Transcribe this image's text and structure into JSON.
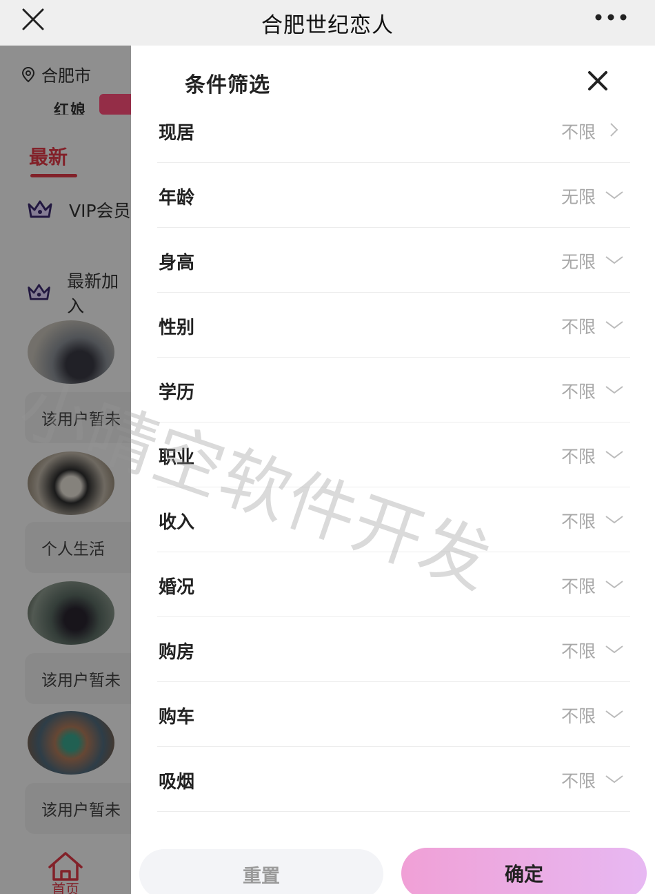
{
  "topbar": {
    "title": "合肥世纪恋人"
  },
  "background": {
    "location": "合肥市",
    "banner_text": "红娘",
    "tab_new": "最新",
    "vip_row": "VIP会员",
    "newest_row": "最新加入",
    "cards": [
      "该用户暂未",
      "个人生活",
      "该用户暂未",
      "该用户暂未"
    ],
    "home_label": "首页"
  },
  "panel": {
    "title": "条件筛选",
    "rows": [
      {
        "label": "现居",
        "value": "不限",
        "arrow": "chevron-right-icon"
      },
      {
        "label": "年龄",
        "value": "无限",
        "arrow": "chevron-down-icon"
      },
      {
        "label": "身高",
        "value": "无限",
        "arrow": "chevron-down-icon"
      },
      {
        "label": "性别",
        "value": "不限",
        "arrow": "chevron-down-icon"
      },
      {
        "label": "学历",
        "value": "不限",
        "arrow": "chevron-down-icon"
      },
      {
        "label": "职业",
        "value": "不限",
        "arrow": "chevron-down-icon"
      },
      {
        "label": "收入",
        "value": "不限",
        "arrow": "chevron-down-icon"
      },
      {
        "label": "婚况",
        "value": "不限",
        "arrow": "chevron-down-icon"
      },
      {
        "label": "购房",
        "value": "不限",
        "arrow": "chevron-down-icon"
      },
      {
        "label": "购车",
        "value": "不限",
        "arrow": "chevron-down-icon"
      },
      {
        "label": "吸烟",
        "value": "不限",
        "arrow": "chevron-down-icon"
      }
    ],
    "reset_label": "重置",
    "confirm_label": "确定"
  },
  "watermark": "小晴空软件开发",
  "colors": {
    "accent_red": "#e03a48",
    "confirm_gradient_start": "#f0a0d6",
    "confirm_gradient_end": "#e7b8f2",
    "value_gray": "#a8a8a8"
  }
}
